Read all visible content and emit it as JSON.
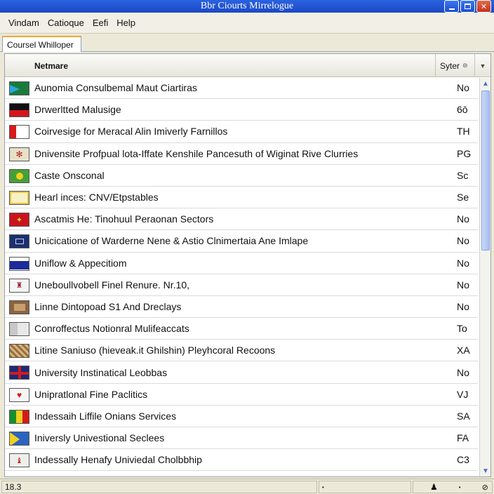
{
  "window": {
    "title": "Bbr Ciourts Mirrelogue"
  },
  "menu": [
    "Vindam",
    "Catioque",
    "Eefi",
    "Help"
  ],
  "tab": {
    "label": "Coursel Whilloper"
  },
  "list": {
    "columns": {
      "name": "Netmare",
      "syter": "Syter"
    },
    "rows": [
      {
        "name": "Aunomia Consulbemal Maut Ciartiras",
        "code": "No",
        "flag": "green-blue"
      },
      {
        "name": "Drwerltted Malusige",
        "code": "6ō",
        "flag": "black-red"
      },
      {
        "name": "Coirvesige for Meracal Alin Imiverly Farnillos",
        "code": "TH",
        "flag": "red-white"
      },
      {
        "name": "Dnivensite Profpual lota-Iffate Kenshile Pancesuth of Wiginat Rive Clurries",
        "code": "PG",
        "flag": "emblem-red"
      },
      {
        "name": "Caste Onsconal",
        "code": "Sc",
        "flag": "green-yellow"
      },
      {
        "name": "Hearl inces: CNV/Etpstables",
        "code": "Se",
        "flag": "white-yellow"
      },
      {
        "name": "Ascatmis He: Tinohuul Peraonan Sectors",
        "code": "No",
        "flag": "red-emblem"
      },
      {
        "name": "Unicicatione of Warderne Nene & Astio Clnimertaia Ane Imlape",
        "code": "No",
        "flag": "navy-emblem"
      },
      {
        "name": "Uniflow & Appecitiom",
        "code": "No",
        "flag": "white-blue"
      },
      {
        "name": "Uneboullvobell Finel Renure. Nr.10,",
        "code": "No",
        "flag": "white-emblem"
      },
      {
        "name": "Linne Dintopoad S1 And Dreclays",
        "code": "No",
        "flag": "brown-emblem"
      },
      {
        "name": "Conroffectus Notionral Mulifeaccats",
        "code": "To",
        "flag": "grey-white"
      },
      {
        "name": "Litine Saniuso (hieveak.it Ghilshin) Pleyhcoral Recoons",
        "code": "XA",
        "flag": "brown-pattern"
      },
      {
        "name": "University Instinatical Leobbas",
        "code": "No",
        "flag": "union-jack"
      },
      {
        "name": "Unipratlonal Fine Paclitics",
        "code": "VJ",
        "flag": "white-redleaf"
      },
      {
        "name": "Indessaih Liffile Onians Services",
        "code": "SA",
        "flag": "green-yellow-red"
      },
      {
        "name": "Iniversly Univestional Seclees",
        "code": "FA",
        "flag": "blue-yellow-triangle"
      },
      {
        "name": "Indessally Henafy Univiedal Cholbbhip",
        "code": "C3",
        "flag": "white-emblem2"
      }
    ]
  },
  "status": {
    "left": "18.3"
  }
}
